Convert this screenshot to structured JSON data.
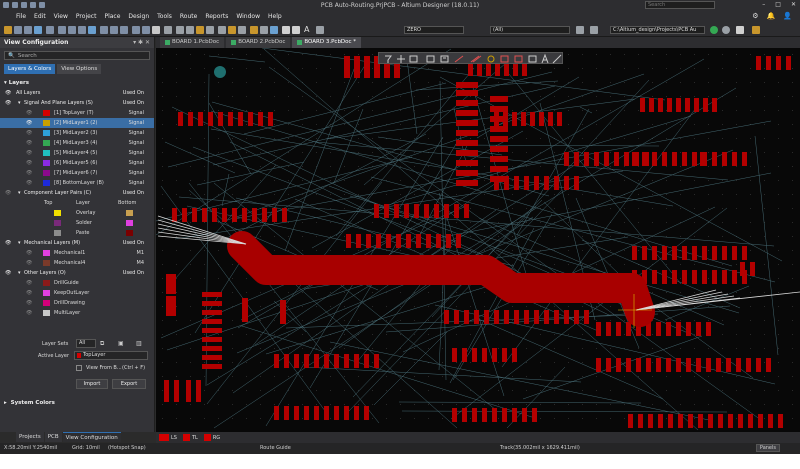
{
  "window": {
    "title": "PCB Auto-Routing.PrjPCB - Altium Designer (18.0.11)",
    "search_placeholder": "Search"
  },
  "menu": [
    "File",
    "Edit",
    "View",
    "Project",
    "Place",
    "Design",
    "Tools",
    "Route",
    "Reports",
    "Window",
    "Help"
  ],
  "toolbar": {
    "layer_combo": "ZERO",
    "filter_combo": "(All)",
    "project_path": "C:\\Altium_design\\Projects\\PCB Au"
  },
  "panel": {
    "title": "View Configuration",
    "search_placeholder": "Search",
    "tabs": [
      "Layers & Colors",
      "View Options"
    ],
    "layers_header": "Layers",
    "all_layers": "All Layers",
    "used_on": "Used On",
    "signal_group": "Signal And Plane Layers (S)",
    "signal_used": "Used On",
    "signal_layers": [
      {
        "name": "[1] TopLayer (T)",
        "type": "Signal",
        "color": "#d40000"
      },
      {
        "name": "[2] MidLayer1 (2)",
        "type": "Signal",
        "color": "#c8a000"
      },
      {
        "name": "[3] MidLayer2 (3)",
        "type": "Signal",
        "color": "#2ea0d8"
      },
      {
        "name": "[4] MidLayer3 (4)",
        "type": "Signal",
        "color": "#34a853"
      },
      {
        "name": "[5] MidLayer4 (5)",
        "type": "Signal",
        "color": "#20c0c0"
      },
      {
        "name": "[6] MidLayer5 (6)",
        "type": "Signal",
        "color": "#8a2be2"
      },
      {
        "name": "[7] MidLayer6 (7)",
        "type": "Signal",
        "color": "#8b0a8b"
      },
      {
        "name": "[8] BottomLayer (B)",
        "type": "Signal",
        "color": "#1e2ad8"
      }
    ],
    "component_group": "Component Layer Pairs (C)",
    "component_used": "Used On",
    "component_cols": [
      "Top",
      "Layer",
      "Bottom"
    ],
    "component_layers": [
      {
        "name": "Overlay",
        "top_color": "#f0e000",
        "bottom_color": "#c8a050"
      },
      {
        "name": "Solder",
        "top_color": "#7a2a7a",
        "bottom_color": "#e040e0"
      },
      {
        "name": "Paste",
        "top_color": "#8c8c8c",
        "bottom_color": "#7a0000"
      }
    ],
    "mech_group": "Mechanical Layers (M)",
    "mech_used": "Used On",
    "mech_layers": [
      {
        "name": "Mechanical1",
        "code": "M1",
        "color": "#e040e0"
      },
      {
        "name": "Mechanical4",
        "code": "M4",
        "color": "#7a3a2a"
      }
    ],
    "other_group": "Other Layers (O)",
    "other_used": "Used On",
    "other_layers": [
      {
        "name": "DrillGuide",
        "color": "#8b1a1a"
      },
      {
        "name": "KeepOutLayer",
        "color": "#e040e0"
      },
      {
        "name": "DrillDrawing",
        "color": "#d4007a"
      },
      {
        "name": "MultiLayer",
        "color": "#c8c8c8"
      }
    ],
    "layer_sets_label": "Layer Sets",
    "layer_sets_value": "All",
    "active_layer_label": "Active Layer",
    "active_layer_value": "TopLayer",
    "view_from_label": "View From B...",
    "view_from_shortcut": "(Ctrl + F)",
    "import_label": "Import",
    "export_label": "Export",
    "system_colors": "System Colors"
  },
  "panel_tabs": [
    "Projects",
    "PCB",
    "View Configuration"
  ],
  "doc_tabs": [
    "BOARD 1.PcbDoc",
    "BOARD 2.PcbDoc",
    "BOARD 3.PcbDoc *"
  ],
  "layer_tabs": [
    {
      "label": "LS",
      "color": "#d40000"
    },
    {
      "label": "TL",
      "color": "#d40000"
    },
    {
      "label": "RG",
      "color": "#d40000"
    }
  ],
  "status": {
    "coords": "X:58.20mil Y:2540mil",
    "grid": "Grid: 10mil",
    "snap": "(Hotspot Snap)",
    "mode": "Route Guide",
    "track": "Track(35.002mil x 1629.411mil)",
    "panels": "Panels"
  }
}
